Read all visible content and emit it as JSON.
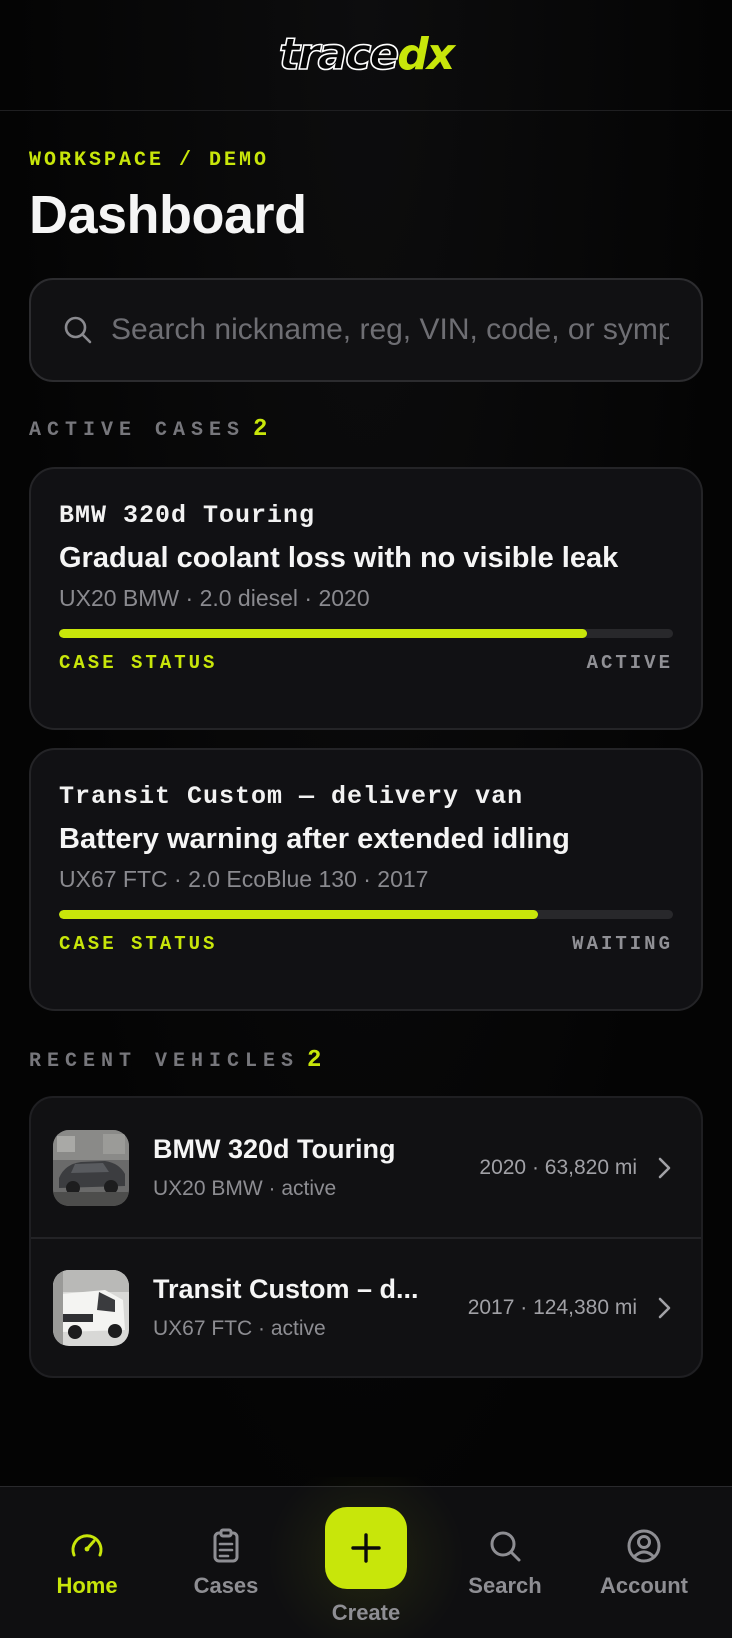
{
  "brand": {
    "logo_part1": "trace",
    "logo_part2": "dx",
    "accent": "#c8e60a"
  },
  "header": {
    "breadcrumb": "WORKSPACE / DEMO",
    "title": "Dashboard"
  },
  "search": {
    "placeholder": "Search nickname, reg, VIN, code, or symptom",
    "value": ""
  },
  "active_cases": {
    "label": "ACTIVE CASES",
    "count": "2",
    "items": [
      {
        "vehicle": "BMW 320d Touring",
        "title": "Gradual coolant loss with no visible leak",
        "meta": "UX20 BMW · 2.0 diesel · 2020",
        "progress": 0.86,
        "status_label": "CASE STATUS",
        "status": "ACTIVE"
      },
      {
        "vehicle": "Transit Custom — delivery van",
        "title": "Battery warning after extended idling",
        "meta": "UX67 FTC · 2.0 EcoBlue 130 · 2017",
        "progress": 0.78,
        "status_label": "CASE STATUS",
        "status": "WAITING"
      }
    ]
  },
  "recent_vehicles": {
    "label": "RECENT VEHICLES",
    "count": "2",
    "items": [
      {
        "name": "BMW 320d Touring",
        "sub": "UX20 BMW · active",
        "stats": "2020 · 63,820 mi",
        "icon": "car-photo"
      },
      {
        "name": "Transit Custom – d...",
        "sub": "UX67 FTC · active",
        "stats": "2017 · 124,380 mi",
        "icon": "van-photo"
      }
    ]
  },
  "nav": {
    "home": "Home",
    "cases": "Cases",
    "create": "Create",
    "search": "Search",
    "account": "Account"
  }
}
